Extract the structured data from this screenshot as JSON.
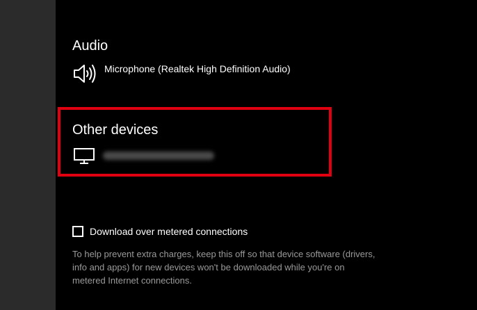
{
  "audio": {
    "title": "Audio",
    "device_icon": "speaker-icon",
    "device_name": "Microphone (Realtek High Definition Audio)"
  },
  "other_devices": {
    "title": "Other devices",
    "device_icon": "monitor-icon",
    "highlight_color": "#e0000f"
  },
  "metered": {
    "checkbox_label": "Download over metered connections",
    "checked": false,
    "help_text": "To help prevent extra charges, keep this off so that device software (drivers, info and apps) for new devices won't be downloaded while you're on metered Internet connections."
  },
  "colors": {
    "background": "#000000",
    "sidebar": "#2b2b2b",
    "secondary_text": "#9a9a9a"
  }
}
